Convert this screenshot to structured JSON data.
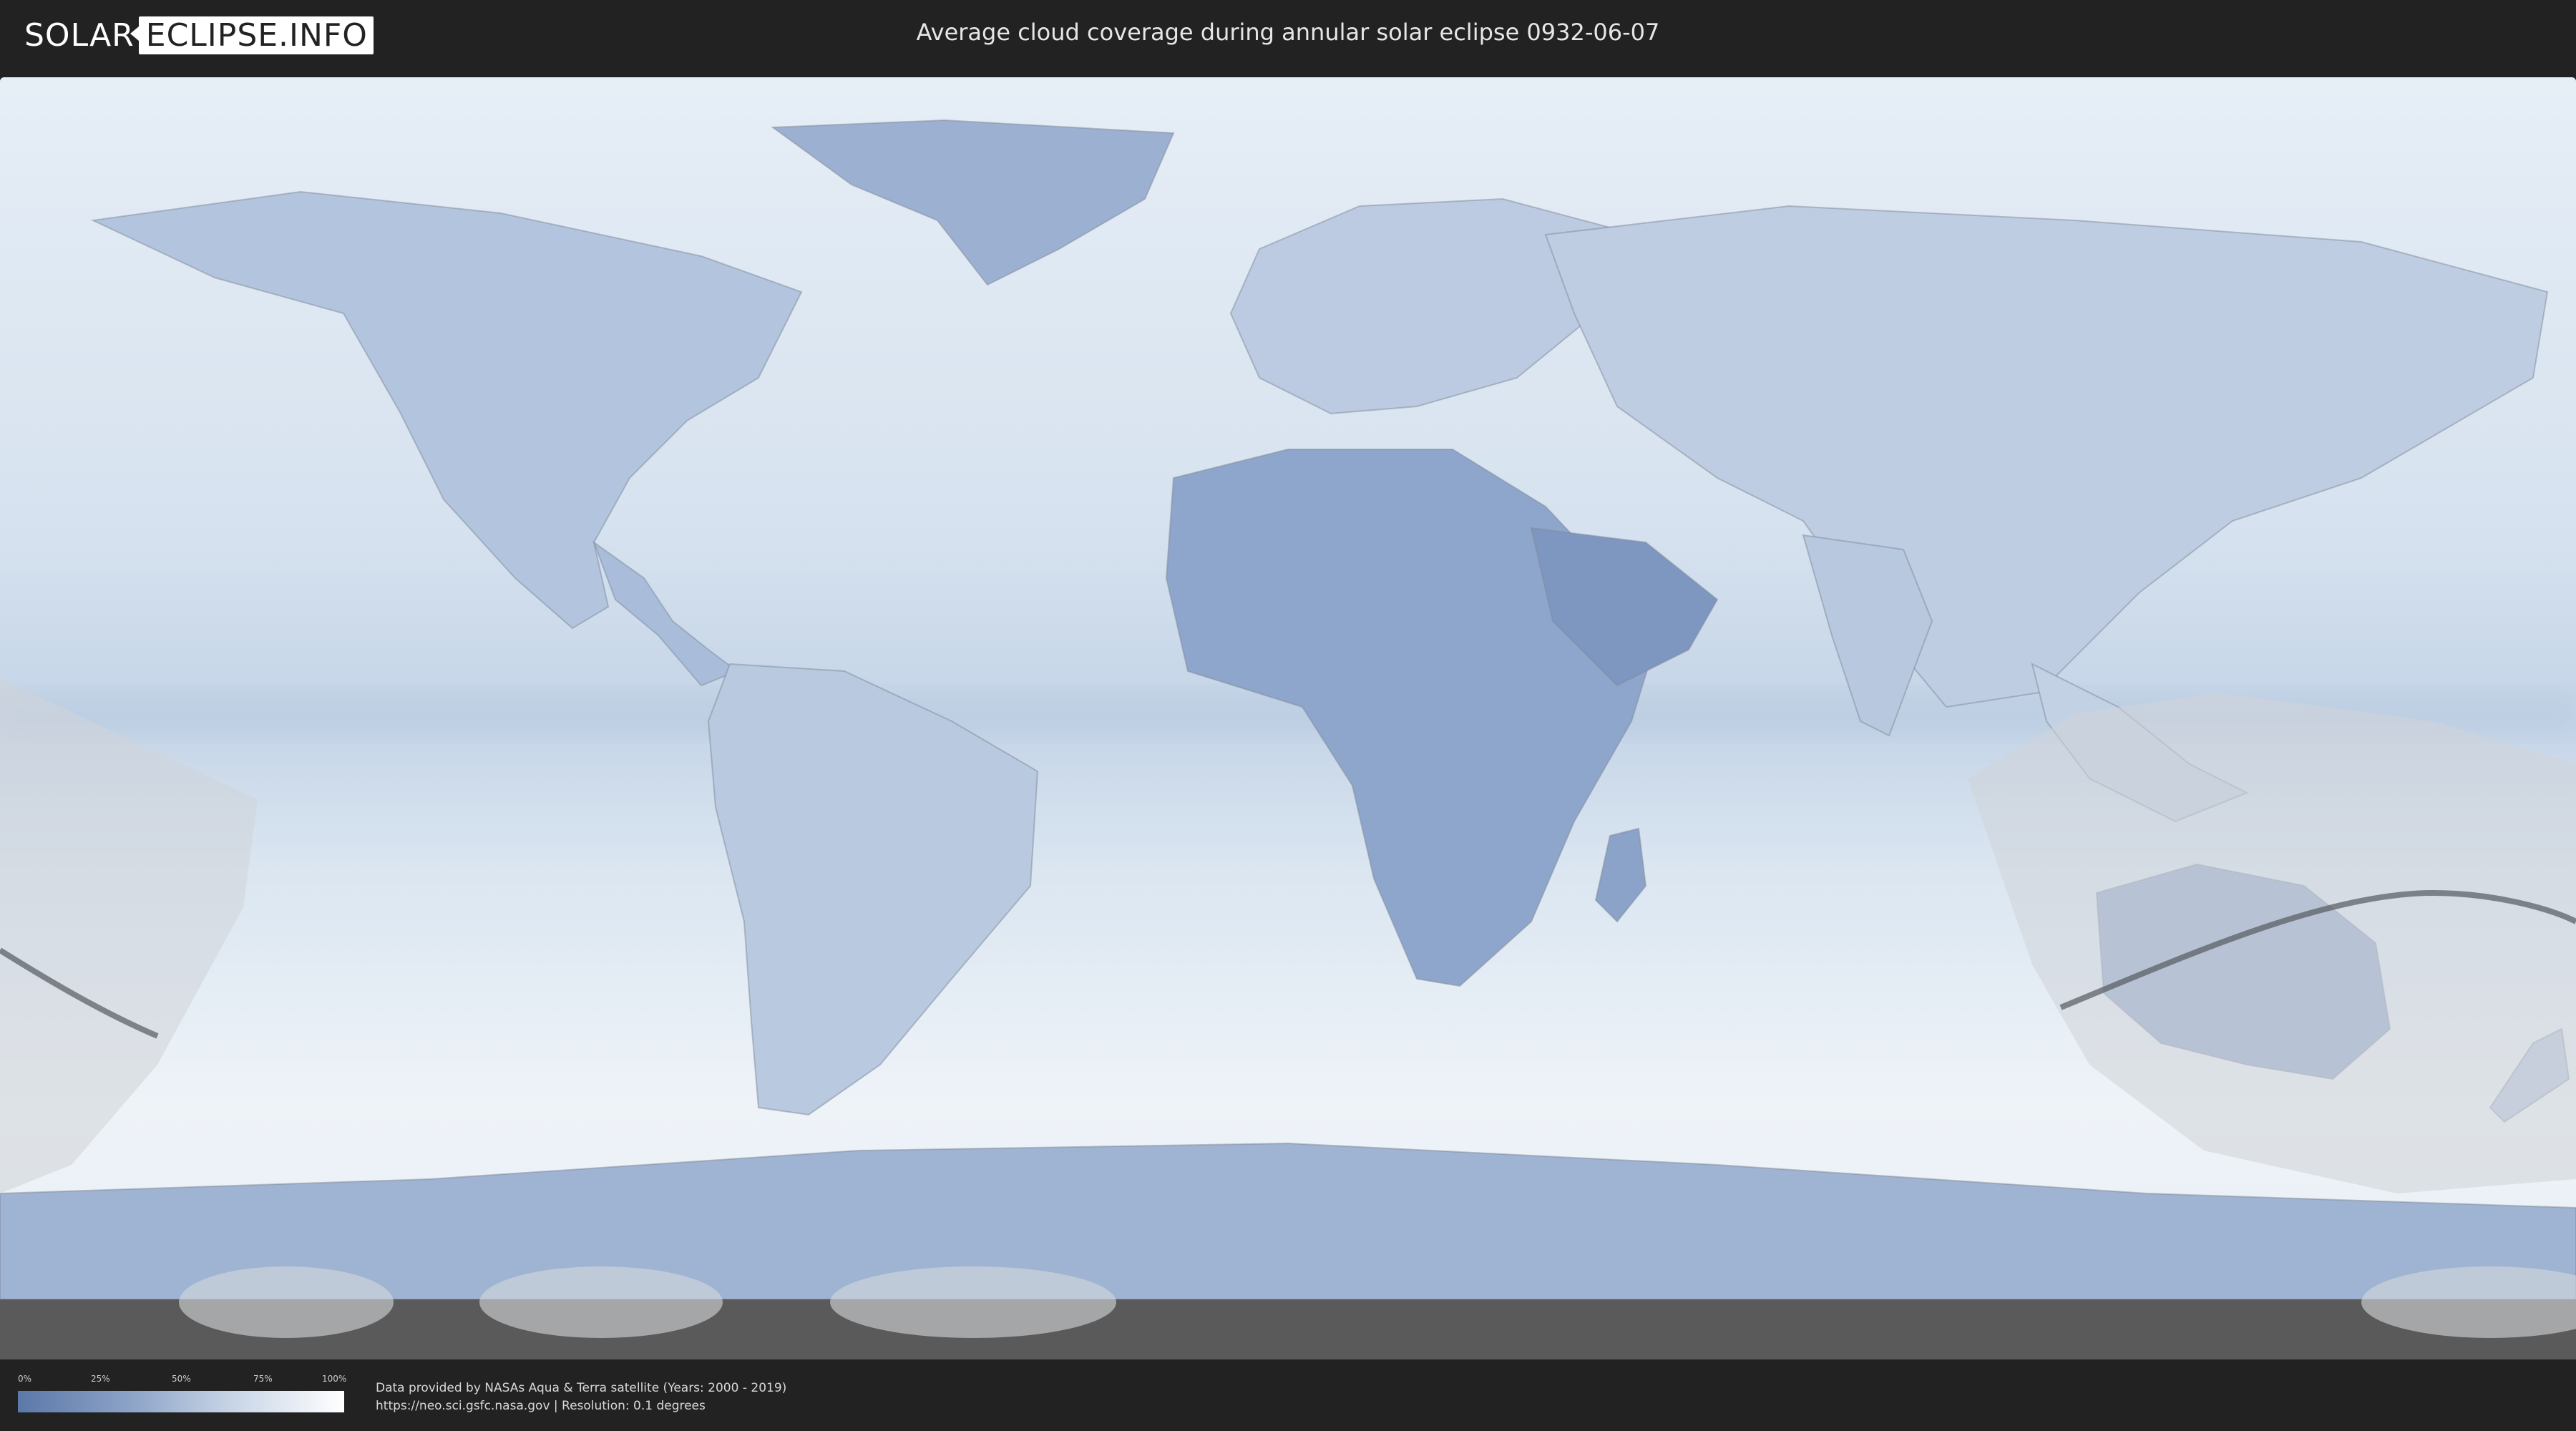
{
  "header": {
    "logo_left": "SOLAR",
    "logo_right": "ECLIPSE.INFO",
    "title": "Average cloud coverage during annular solar eclipse 0932-06-07"
  },
  "legend": {
    "ticks": [
      "0%",
      "25%",
      "50%",
      "75%",
      "100%"
    ],
    "gradient_colors": [
      "#5c78a8",
      "#ffffff"
    ]
  },
  "footer": {
    "line1": "Data provided by NASAs Aqua & Terra satellite (Years: 2000 - 2019)",
    "line2": "https://neo.sci.gsfc.nasa.gov | Resolution: 0.1 degrees"
  },
  "colors": {
    "background": "#222222",
    "cloud_clear": "#5c78a8",
    "cloud_full": "#ffffff",
    "eclipse_zone": "#cfd3d8",
    "eclipse_path": "#555a60"
  }
}
